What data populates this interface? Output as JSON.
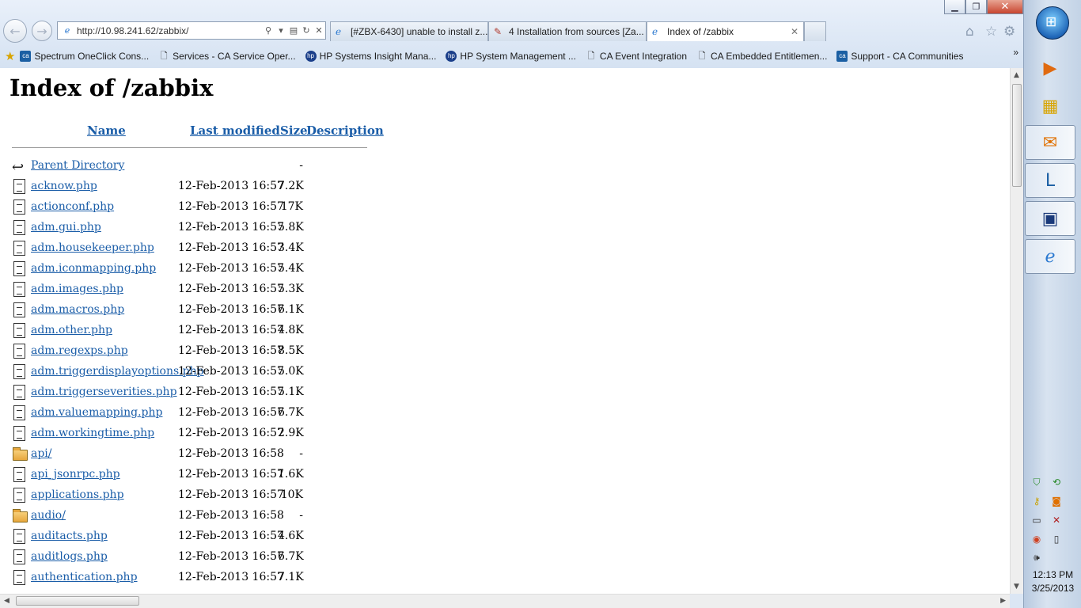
{
  "browser": {
    "address": "http://10.98.241.62/zabbix/",
    "tabs": [
      {
        "label": "[#ZBX-6430] unable to install z..."
      },
      {
        "label": "4 Installation from sources [Za..."
      },
      {
        "label": "Index of /zabbix"
      }
    ],
    "favorites": [
      {
        "label": "Spectrum OneClick Cons...",
        "icon": "ca-icon"
      },
      {
        "label": "Services - CA Service Oper...",
        "icon": "page-icon"
      },
      {
        "label": "HP Systems Insight Mana...",
        "icon": "hp-icon"
      },
      {
        "label": "HP System Management ...",
        "icon": "hp-icon"
      },
      {
        "label": "CA Event Integration",
        "icon": "page-icon"
      },
      {
        "label": "CA Embedded Entitlemen...",
        "icon": "page-icon"
      },
      {
        "label": "Support - CA Communities",
        "icon": "ca-icon"
      }
    ],
    "more_chevron": "»"
  },
  "listing": {
    "title": "Index of /zabbix",
    "columns": {
      "name": "Name",
      "modified": "Last modified",
      "size": "Size",
      "description": "Description"
    },
    "rows": [
      {
        "type": "parent",
        "name": "Parent Directory",
        "modified": "",
        "size": "-"
      },
      {
        "type": "file",
        "name": "acknow.php",
        "modified": "12-Feb-2013 16:57",
        "size": "7.2K"
      },
      {
        "type": "file",
        "name": "actionconf.php",
        "modified": "12-Feb-2013 16:57",
        "size": "17K"
      },
      {
        "type": "file",
        "name": "adm.gui.php",
        "modified": "12-Feb-2013 16:57",
        "size": "5.8K"
      },
      {
        "type": "file",
        "name": "adm.housekeeper.php",
        "modified": "12-Feb-2013 16:57",
        "size": "3.4K"
      },
      {
        "type": "file",
        "name": "adm.iconmapping.php",
        "modified": "12-Feb-2013 16:57",
        "size": "5.4K"
      },
      {
        "type": "file",
        "name": "adm.images.php",
        "modified": "12-Feb-2013 16:57",
        "size": "5.3K"
      },
      {
        "type": "file",
        "name": "adm.macros.php",
        "modified": "12-Feb-2013 16:57",
        "size": "6.1K"
      },
      {
        "type": "file",
        "name": "adm.other.php",
        "modified": "12-Feb-2013 16:57",
        "size": "4.8K"
      },
      {
        "type": "file",
        "name": "adm.regexps.php",
        "modified": "12-Feb-2013 16:57",
        "size": "8.5K"
      },
      {
        "type": "file",
        "name": "adm.triggerdisplayoptions.php",
        "modified": "12-Feb-2013 16:57",
        "size": "5.0K"
      },
      {
        "type": "file",
        "name": "adm.triggerseverities.php",
        "modified": "12-Feb-2013 16:57",
        "size": "5.1K"
      },
      {
        "type": "file",
        "name": "adm.valuemapping.php",
        "modified": "12-Feb-2013 16:57",
        "size": "6.7K"
      },
      {
        "type": "file",
        "name": "adm.workingtime.php",
        "modified": "12-Feb-2013 16:57",
        "size": "2.9K"
      },
      {
        "type": "folder",
        "name": "api/",
        "modified": "12-Feb-2013 16:58",
        "size": "-"
      },
      {
        "type": "file",
        "name": "api_jsonrpc.php",
        "modified": "12-Feb-2013 16:57",
        "size": "1.6K"
      },
      {
        "type": "file",
        "name": "applications.php",
        "modified": "12-Feb-2013 16:57",
        "size": "10K"
      },
      {
        "type": "folder",
        "name": "audio/",
        "modified": "12-Feb-2013 16:58",
        "size": "-"
      },
      {
        "type": "file",
        "name": "auditacts.php",
        "modified": "12-Feb-2013 16:57",
        "size": "4.6K"
      },
      {
        "type": "file",
        "name": "auditlogs.php",
        "modified": "12-Feb-2013 16:57",
        "size": "6.7K"
      },
      {
        "type": "file",
        "name": "authentication.php",
        "modified": "12-Feb-2013 16:57",
        "size": "7.1K"
      }
    ]
  },
  "taskbar": {
    "time": "12:13 PM",
    "date": "3/25/2013"
  },
  "colors": {
    "link": "#1a5da8",
    "chrome_bg": "#dbe6f4"
  }
}
